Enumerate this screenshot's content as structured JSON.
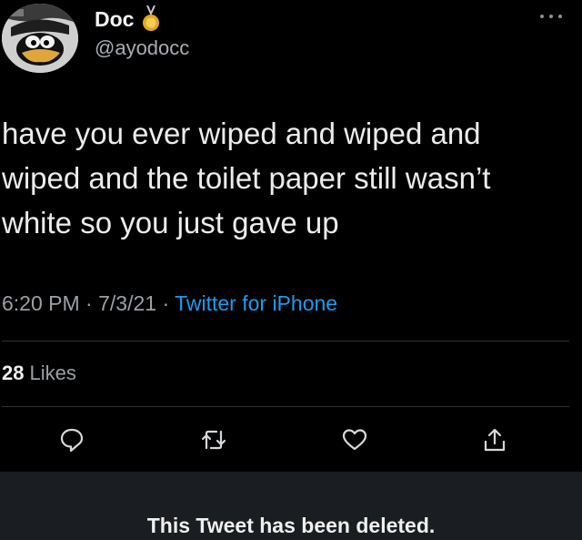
{
  "author": {
    "display_name": "Doc",
    "handle": "@ayodocc",
    "avatar_icon": "cartoon-duck-avatar",
    "badge_icon": "medal-icon"
  },
  "tweet": {
    "text": "have you ever wiped and wiped and wiped and the toilet paper still wasn’t white so you just gave up",
    "time": "6:20 PM",
    "separator": "·",
    "date": "7/3/21",
    "source": "Twitter for iPhone"
  },
  "stats": {
    "likes_count": "28",
    "likes_label": "Likes"
  },
  "actions": [
    {
      "name": "reply",
      "icon": "speech-bubble-icon"
    },
    {
      "name": "retweet",
      "icon": "retweet-icon"
    },
    {
      "name": "like",
      "icon": "heart-icon"
    },
    {
      "name": "share",
      "icon": "share-icon"
    }
  ],
  "notice": {
    "deleted_text": "This Tweet has been deleted."
  },
  "colors": {
    "background": "#000000",
    "text": "#e7e9ea",
    "muted": "#9aa0a6",
    "link": "#1d9bf0",
    "notice_bar": "#1a1d21"
  }
}
